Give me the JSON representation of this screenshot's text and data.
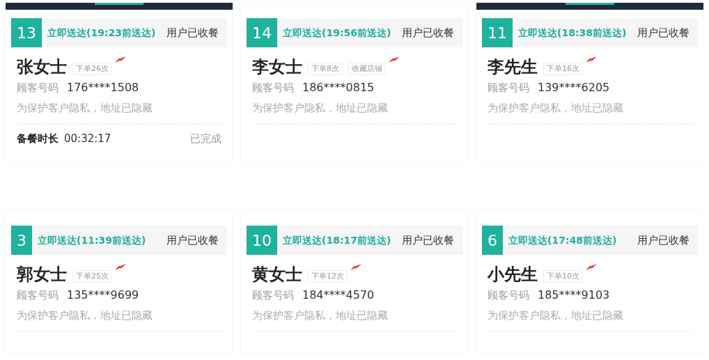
{
  "orders": [
    {
      "tab_bar": true,
      "number": "13",
      "delivery": "立即送达(19:23前送达)",
      "status": "用户已收餐",
      "customer": "张女士",
      "tags": [
        "下单26次"
      ],
      "phone_label": "顾客号码",
      "phone": "176****1508",
      "privacy_note": "为保护客户隐私，地址已隐藏",
      "prep": {
        "label": "备餐时长",
        "value": "00:32:17",
        "status": "已完成"
      }
    },
    {
      "tab_bar": false,
      "number": "14",
      "delivery": "立即送达(19:56前送达)",
      "status": "用户已收餐",
      "customer": "李女士",
      "tags": [
        "下单8次",
        "收藏店铺"
      ],
      "phone_label": "顾客号码",
      "phone": "186****0815",
      "privacy_note": "为保护客户隐私，地址已隐藏"
    },
    {
      "tab_bar": true,
      "number": "11",
      "delivery": "立即送达(18:38前送达)",
      "status": "用户已收餐",
      "customer": "李先生",
      "tags": [
        "下单16次"
      ],
      "phone_label": "顾客号码",
      "phone": "139****6205",
      "privacy_note": "为保护客户隐私，地址已隐藏"
    },
    {
      "tab_bar": false,
      "number": "3",
      "delivery": "立即送达(11:39前送达)",
      "status": "用户已收餐",
      "customer": "郭女士",
      "tags": [
        "下单25次"
      ],
      "phone_label": "顾客号码",
      "phone": "135****9699",
      "privacy_note": "为保护客户隐私，地址已隐藏"
    },
    {
      "tab_bar": false,
      "number": "10",
      "delivery": "立即送达(18:17前送达)",
      "status": "用户已收餐",
      "customer": "黄女士",
      "tags": [
        "下单12次"
      ],
      "phone_label": "顾客号码",
      "phone": "184****4570",
      "privacy_note": "为保护客户隐私，地址已隐藏"
    },
    {
      "tab_bar": false,
      "number": "6",
      "delivery": "立即送达(17:48前送达)",
      "status": "用户已收餐",
      "customer": "小先生",
      "tags": [
        "下单10次"
      ],
      "phone_label": "顾客号码",
      "phone": "185****9103",
      "privacy_note": "为保护客户隐私，地址已隐藏"
    }
  ]
}
